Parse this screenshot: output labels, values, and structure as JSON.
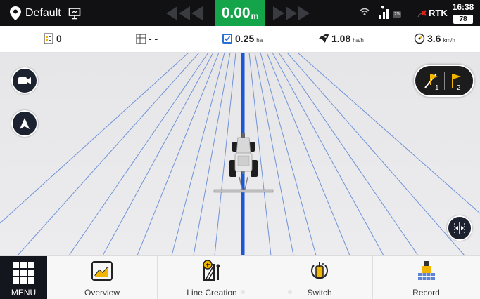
{
  "top_bar": {
    "profile_name": "Default",
    "speed_value": "0.00",
    "speed_unit": "m",
    "satellite_count": "25",
    "rtk_label": "RTK",
    "time": "16:38",
    "battery": "78",
    "speed_box_color": "#14a54a"
  },
  "info_bar": {
    "line_count": "0",
    "field_value": "- -",
    "area_value": "0.25",
    "area_unit": "ha",
    "work_rate_value": "1.08",
    "work_rate_unit": "ha/h",
    "speed_value": "3.6",
    "speed_unit": "km/h"
  },
  "map_buttons": {
    "camera": "camera-icon",
    "navigation": "navigation-arrow-icon",
    "ab_point_1": "1",
    "ab_point_2": "2",
    "center_align": "center-align-icon"
  },
  "bottom_nav": {
    "menu_label": "MENU",
    "items": [
      {
        "label": "Overview",
        "icon": "overview-chart-icon"
      },
      {
        "label": "Line Creation",
        "icon": "line-creation-icon"
      },
      {
        "label": "Switch",
        "icon": "switch-icon"
      },
      {
        "label": "Record",
        "icon": "record-icon"
      }
    ]
  },
  "colors": {
    "guide_line": "#1a56d6",
    "parallel_lines": "#6f93d9",
    "accent_yellow": "#f2b600",
    "rtk_error": "#e2231a"
  }
}
